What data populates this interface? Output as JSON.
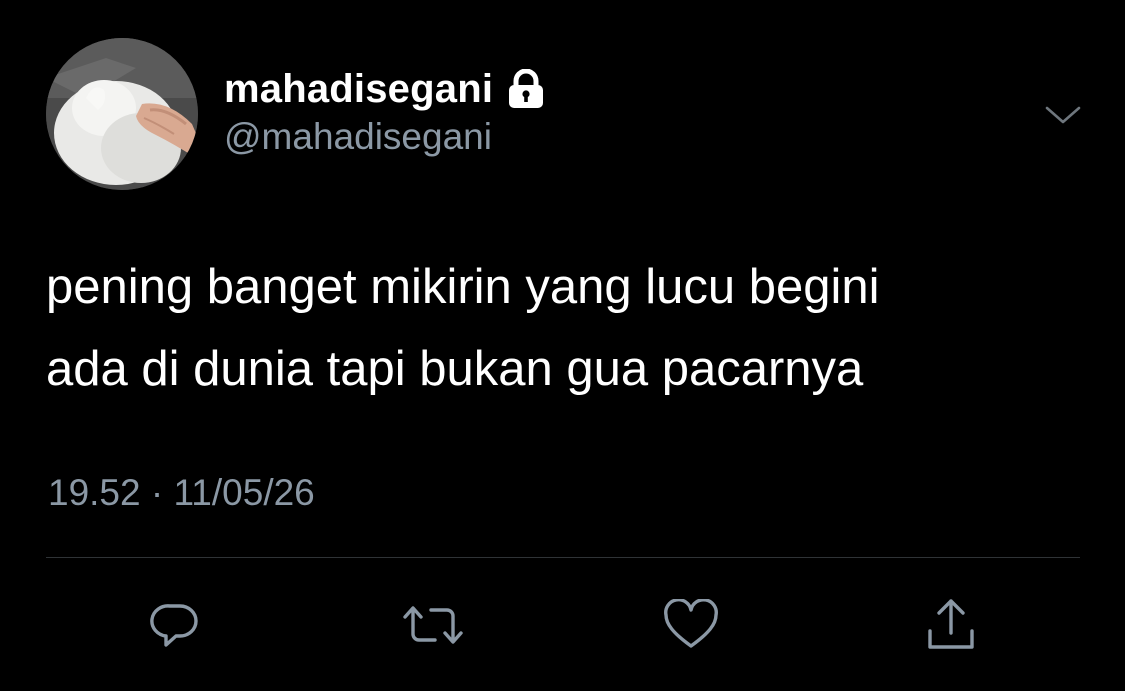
{
  "author": {
    "display_name": "mahadisegani",
    "handle": "@mahadisegani",
    "protected_icon": "lock-icon",
    "avatar": "avatar-photo-white-dog"
  },
  "tweet": {
    "lines": [
      "pening banget mikirin yang lucu begini",
      "ada di dunia tapi bukan gua pacarnya"
    ],
    "timestamp": "19.52 · 11/05/26"
  },
  "menu": {
    "icon": "chevron-down-icon"
  },
  "actions": [
    {
      "name": "reply",
      "icon": "reply-icon"
    },
    {
      "name": "retweet",
      "icon": "retweet-icon"
    },
    {
      "name": "like",
      "icon": "heart-icon"
    },
    {
      "name": "share",
      "icon": "share-icon"
    }
  ],
  "colors": {
    "background": "#000000",
    "primary_text": "#ffffff",
    "secondary_text": "#8b98a5",
    "divider": "#2f3336"
  }
}
